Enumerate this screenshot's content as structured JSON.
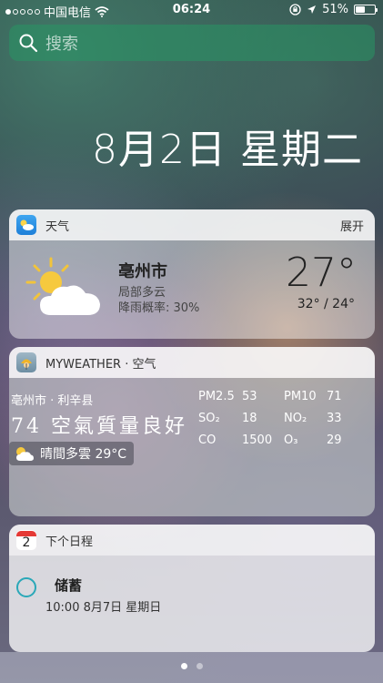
{
  "status_bar": {
    "carrier": "中国电信",
    "time": "06:24",
    "battery": "51%",
    "battery_level": 0.51,
    "signal_bars": 1
  },
  "search": {
    "placeholder": "搜索"
  },
  "date": "8月2日 星期二",
  "weather": {
    "header": "天气",
    "action": "展开",
    "city": "亳州市",
    "condition": "局部多云",
    "rain": "降雨概率: 30%",
    "temp": "27°",
    "hilo": "32° / 24°"
  },
  "myweather": {
    "header": "MYWEATHER · 空气",
    "location": "亳州市 · 利辛县",
    "aqi": "74 空氣質量良好",
    "now": "晴間多雲 29°C",
    "pollutants": [
      {
        "name": "PM2.5",
        "value": "53"
      },
      {
        "name": "SO₂",
        "value": "18"
      },
      {
        "name": "CO",
        "value": "1500"
      },
      {
        "name": "PM10",
        "value": "71"
      },
      {
        "name": "NO₂",
        "value": "33"
      },
      {
        "name": "O₃",
        "value": "29"
      }
    ]
  },
  "calendar": {
    "header": "下个日程",
    "icon_day": "2",
    "event_title": "储蓄",
    "event_time": "10:00 8月7日 星期日"
  },
  "pager": {
    "count": 2,
    "active": 0
  }
}
